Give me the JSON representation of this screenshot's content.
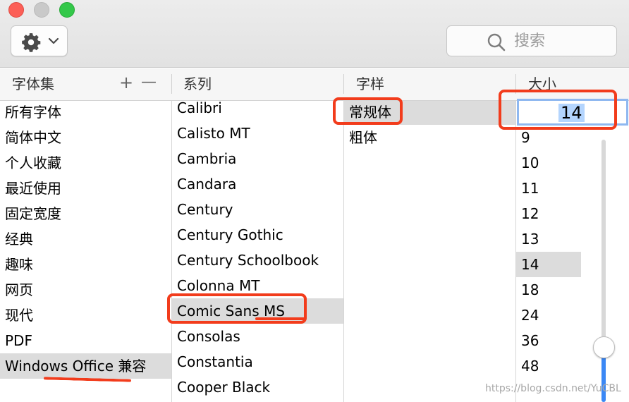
{
  "window": {
    "buttons": [
      "close",
      "minimize",
      "zoom"
    ]
  },
  "toolbar": {
    "action_icon": "gear-icon",
    "search_placeholder": "搜索"
  },
  "headers": {
    "collections": "字体集",
    "add": "+",
    "remove": "—",
    "family": "系列",
    "typeface": "字样",
    "size": "大小"
  },
  "collections": [
    "所有字体",
    "简体中文",
    "个人收藏",
    "最近使用",
    "固定宽度",
    "经典",
    "趣味",
    "网页",
    "现代",
    "PDF",
    "Windows Office 兼容"
  ],
  "collections_selected": "Windows Office 兼容",
  "families": [
    "Calibri",
    "Calisto MT",
    "Cambria",
    "Candara",
    "Century",
    "Century Gothic",
    "Century Schoolbook",
    "Colonna MT",
    "Comic Sans MS",
    "Consolas",
    "Constantia",
    "Cooper Black"
  ],
  "families_selected": "Comic Sans MS",
  "typefaces": [
    "常规体",
    "粗体"
  ],
  "typefaces_selected": "常规体",
  "size": {
    "current": "14",
    "options": [
      "9",
      "10",
      "11",
      "12",
      "13",
      "14",
      "18",
      "24",
      "36",
      "48"
    ],
    "selected": "14",
    "slider_fraction": 0.78
  },
  "watermark": "https://blog.csdn.net/YuCBL",
  "colors": {
    "annotation": "#f23c1c",
    "selection": "#dcdcdc",
    "accent": "#3b88f5"
  }
}
